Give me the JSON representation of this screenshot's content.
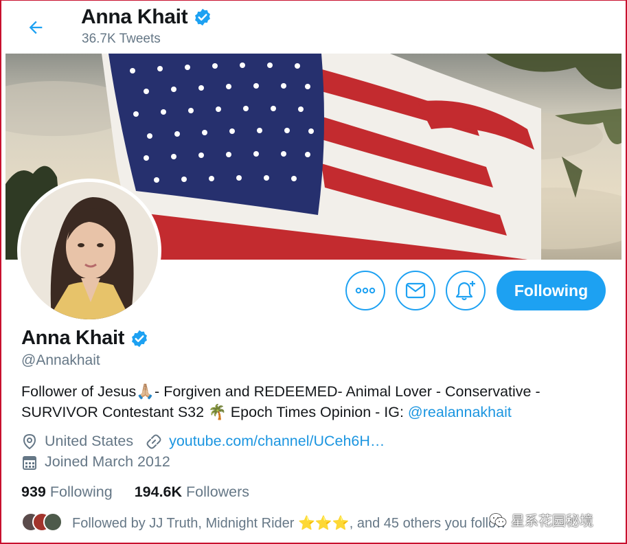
{
  "header": {
    "name": "Anna Khait",
    "tweet_count": "36.7K Tweets"
  },
  "profile": {
    "name": "Anna Khait",
    "handle": "@Annakhait",
    "bio_line1": "Follower of Jesus🙏🏼- Forgiven and REDEEMED- Animal Lover - Conservative -",
    "bio_line2_prefix": "SURVIVOR Contestant S32 🌴 Epoch Times Opinion - IG: ",
    "bio_link": "@realannakhait",
    "location": "United States",
    "website": "youtube.com/channel/UCeh6H…",
    "joined": "Joined March 2012"
  },
  "actions": {
    "following_label": "Following"
  },
  "stats": {
    "following_count": "939",
    "following_label": "Following",
    "followers_count": "194.6K",
    "followers_label": "Followers"
  },
  "followed_by": {
    "text": "Followed by JJ Truth, Midnight Rider ⭐⭐⭐, and 45 others you follow"
  },
  "watermark": {
    "text": "星系花园秘境"
  },
  "colors": {
    "accent": "#1da1f2",
    "link": "#1b95e0",
    "muted": "#657786",
    "verified": "#1da1f2"
  },
  "icons": {
    "back": "arrow-left-icon",
    "verified": "verified-badge-icon",
    "more": "more-icon",
    "message": "envelope-icon",
    "notifications": "bell-plus-icon",
    "location": "location-pin-icon",
    "link": "link-icon",
    "calendar": "calendar-icon"
  }
}
